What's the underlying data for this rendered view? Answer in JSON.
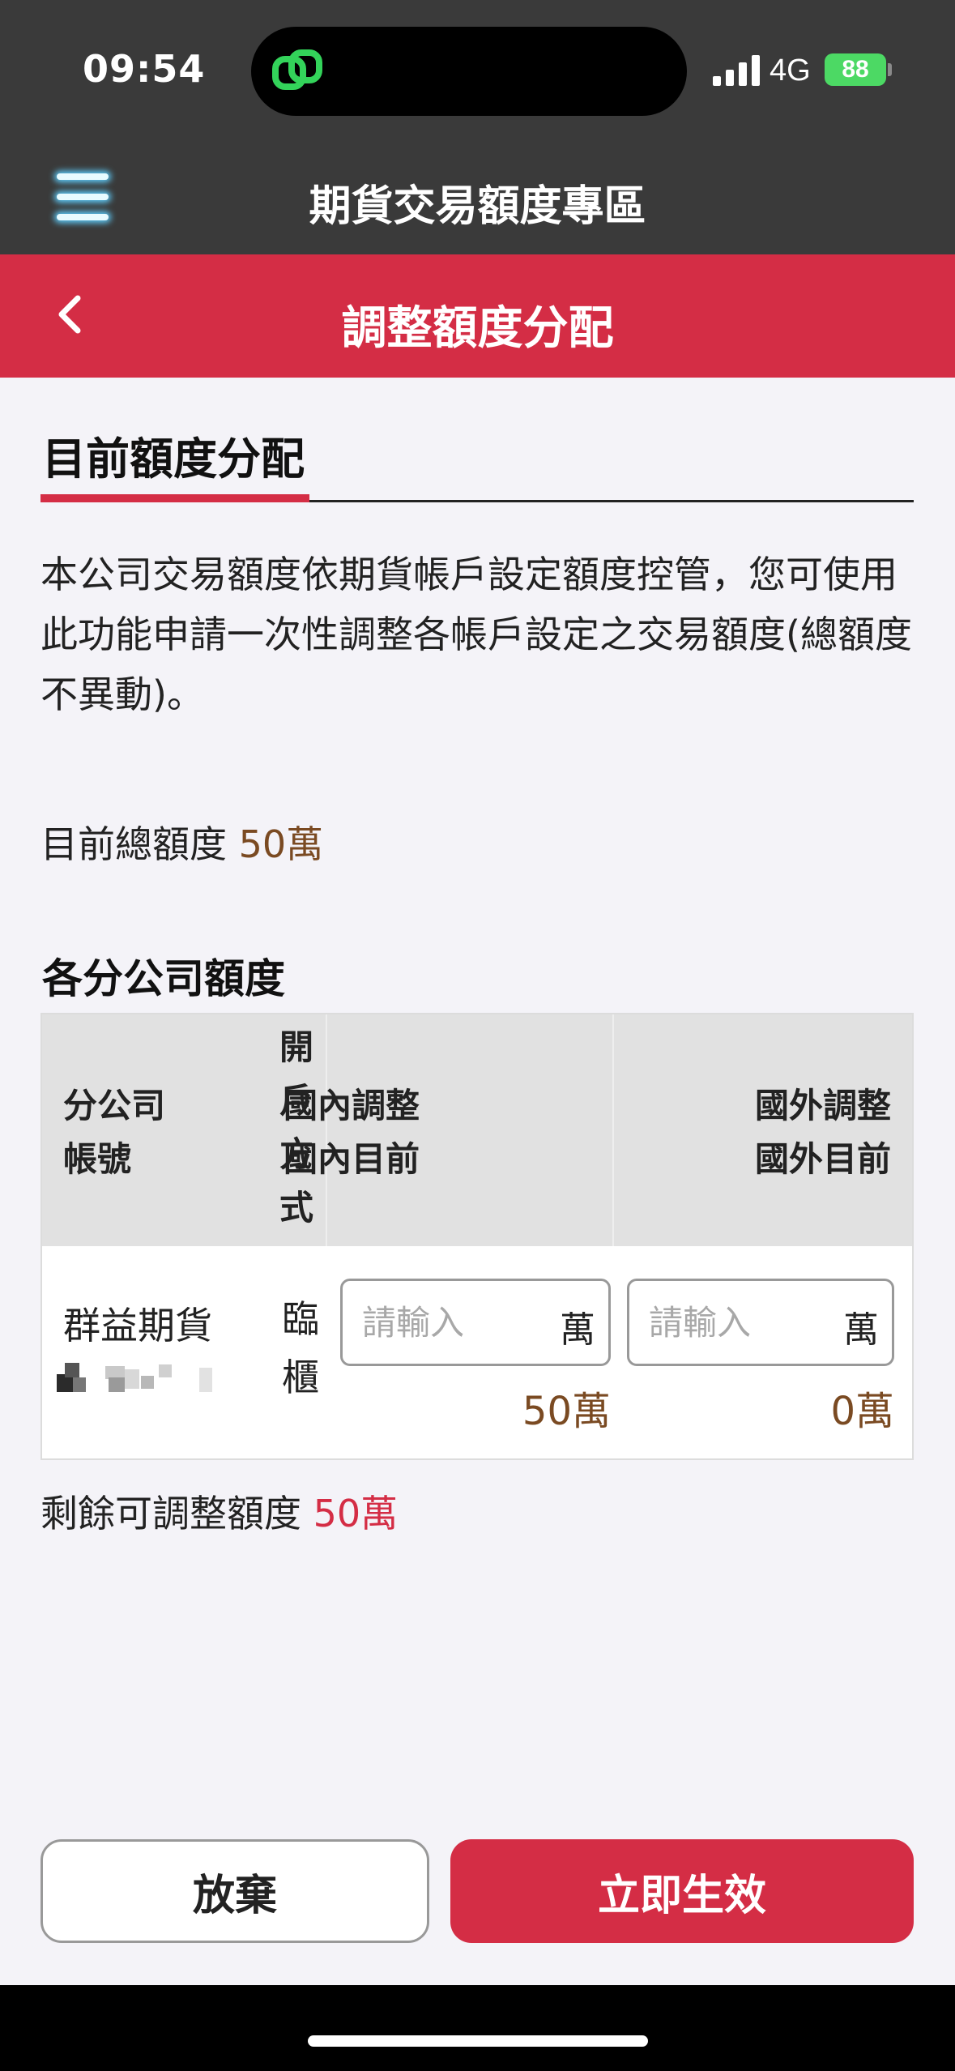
{
  "status_bar": {
    "time": "09:54",
    "network": "4G",
    "battery": "88"
  },
  "header": {
    "title": "期貨交易額度專區"
  },
  "subheader": {
    "title": "調整額度分配"
  },
  "section": {
    "title": "目前額度分配",
    "description": "本公司交易額度依期貨帳戶設定額度控管，您可使用此功能申請一次性調整各帳戶設定之交易額度(總額度不異動)。"
  },
  "total": {
    "label": "目前總額度",
    "value": "50萬"
  },
  "branch_section": {
    "title": "各分公司額度"
  },
  "table": {
    "headers": {
      "branch_line1": "分公司",
      "branch_line2": "帳號",
      "open_method": [
        "開",
        "戶",
        "方",
        "式"
      ],
      "domestic_line1": "國內調整",
      "domestic_line2": "國內目前",
      "foreign_line1": "國外調整",
      "foreign_line2": "國外目前"
    },
    "rows": [
      {
        "branch": "群益期貨",
        "open_method": [
          "臨",
          "櫃"
        ],
        "domestic_placeholder": "請輸入",
        "domestic_unit": "萬",
        "domestic_current": "50萬",
        "foreign_placeholder": "請輸入",
        "foreign_unit": "萬",
        "foreign_current": "0萬"
      }
    ]
  },
  "remaining": {
    "label": "剩餘可調整額度",
    "value": "50萬"
  },
  "buttons": {
    "cancel": "放棄",
    "confirm": "立即生效"
  },
  "colors": {
    "accent": "#d42d45",
    "amount": "#7a4a22",
    "header_bg": "#3a3a3a"
  }
}
